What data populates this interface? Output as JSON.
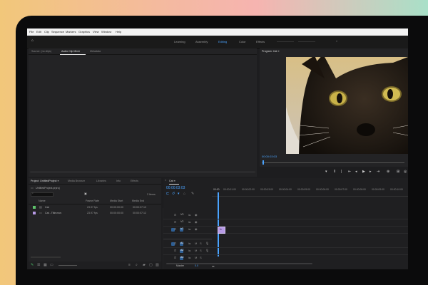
{
  "menu": [
    "File",
    "Edit",
    "Clip",
    "Sequence",
    "Markers",
    "Graphics",
    "View",
    "Window",
    "Help"
  ],
  "workspaces": [
    "Learning",
    "Assembly",
    "Editing",
    "Color",
    "Effects"
  ],
  "source_tabs": [
    "Source: (no clips)",
    "Audio Clip Mixer",
    "Metadata"
  ],
  "program_tab": "Program: Cat ≡",
  "program_timecode": "00:00:03:03",
  "project_tabs": [
    "Project: UntitledProject ≡",
    "Media Browser",
    "Libraries",
    "Info",
    "Effects"
  ],
  "project_path": "UntitledProject.prproj",
  "project_items_count": "2 Items",
  "project_columns": [
    "Name",
    "Frame Rate",
    "Media Start",
    "Media End"
  ],
  "project_rows": [
    {
      "name": "Cat",
      "fps": "23.97 fps",
      "start": "00:00:00:00",
      "end": "00:00:07:13",
      "color": "#5ec36a"
    },
    {
      "name": "Cat - Title.mov",
      "fps": "23.97 fps",
      "start": "00:00:00:00",
      "end": "00:00:07:12",
      "color": "#b79ae6"
    }
  ],
  "timeline_tab": "Cat ≡",
  "timeline_timecode": "00:00:03:03",
  "ruler_times": [
    "00:00",
    "00:00:01:00",
    "00:00:02:00",
    "00:00:03:00",
    "00:00:04:00",
    "00:00:05:00",
    "00:00:06:00",
    "00:00:07:00",
    "00:00:08:00",
    "00:00:09:00",
    "00:00:10:00"
  ],
  "tracks_video": [
    "V3",
    "V2",
    "V1"
  ],
  "tracks_audio": [
    "A1",
    "A2",
    "A3"
  ],
  "track_master": "Master",
  "master_level": "0.0",
  "accent_color": "#4aa3ff"
}
